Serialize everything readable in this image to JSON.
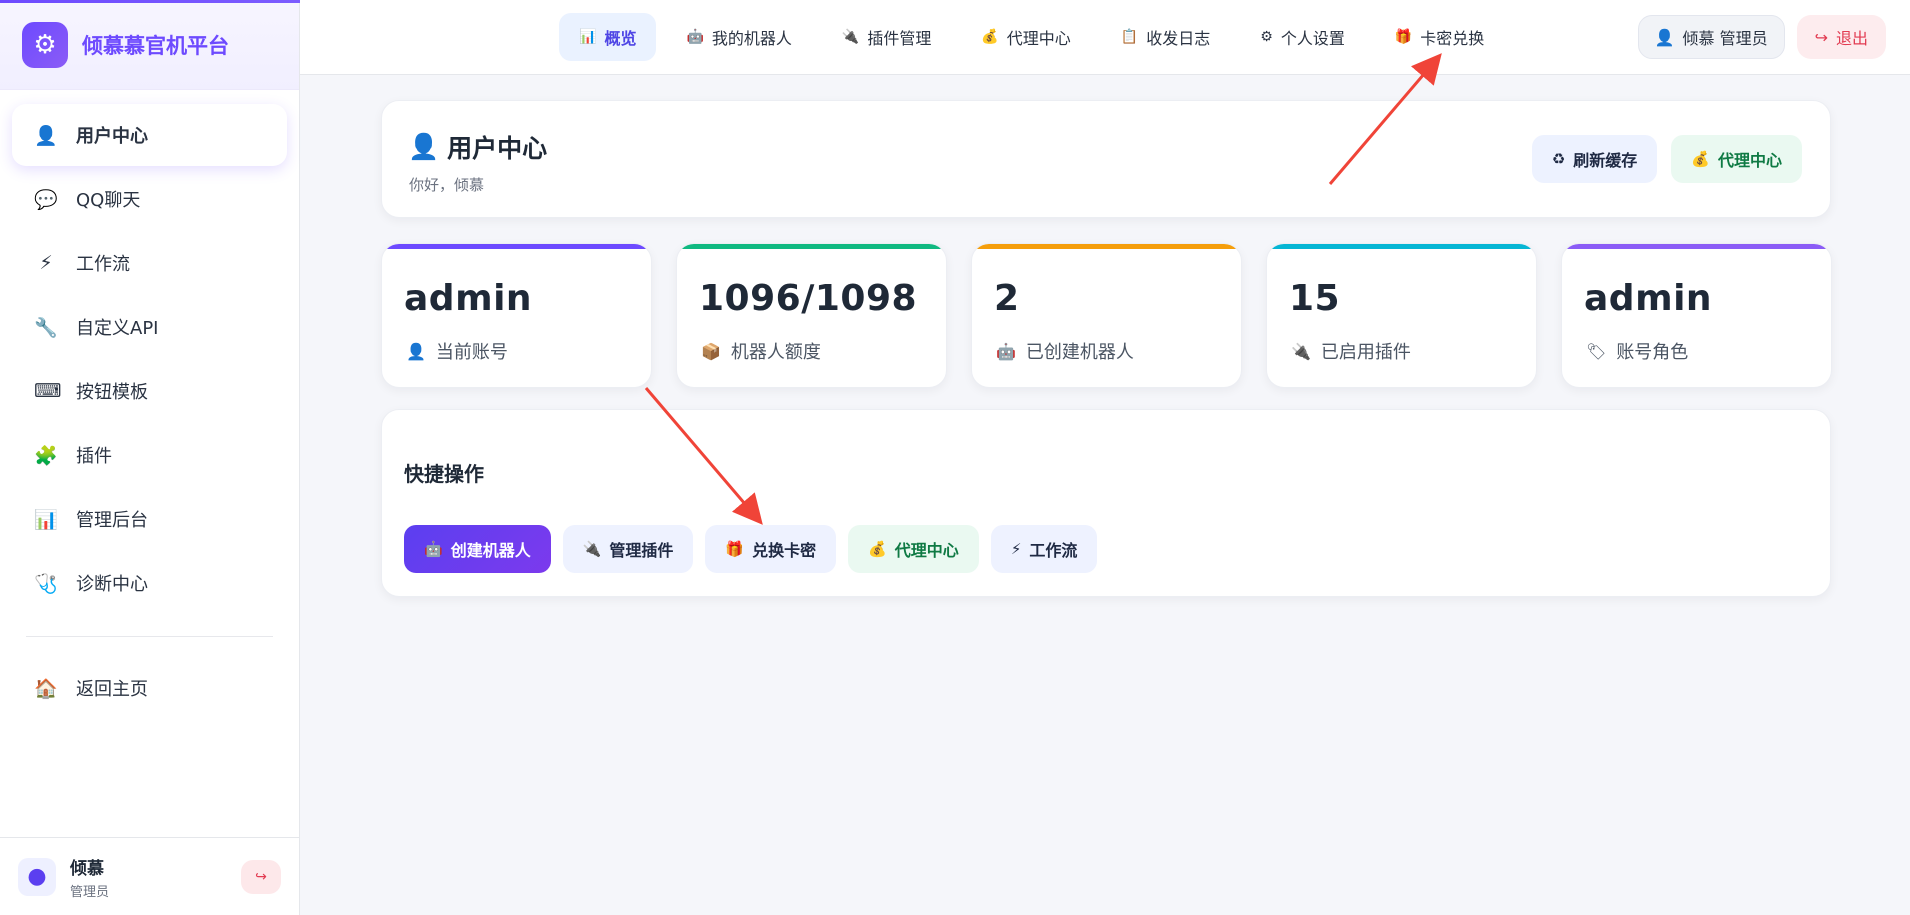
{
  "brand": {
    "title": "倾慕慕官机平台",
    "logo_icon": "gear-icon"
  },
  "sidebar": {
    "items": [
      {
        "label": "用户中心",
        "icon": "👤",
        "icon_name": "user-icon",
        "active": true
      },
      {
        "label": "QQ聊天",
        "icon": "💬",
        "icon_name": "chat-icon"
      },
      {
        "label": "工作流",
        "icon": "⚡",
        "icon_name": "bolt-icon"
      },
      {
        "label": "自定义API",
        "icon": "🔧",
        "icon_name": "wrench-icon"
      },
      {
        "label": "按钮模板",
        "icon": "⌨",
        "icon_name": "keyboard-icon"
      },
      {
        "label": "插件",
        "icon": "🧩",
        "icon_name": "puzzle-icon"
      },
      {
        "label": "管理后台",
        "icon": "📊",
        "icon_name": "chart-icon"
      },
      {
        "label": "诊断中心",
        "icon": "🩺",
        "icon_name": "stethoscope-icon"
      }
    ],
    "home": {
      "label": "返回主页",
      "icon": "🏠"
    },
    "footer": {
      "name": "倾慕",
      "role": "管理员",
      "avatar_icon": "user-circle-icon"
    }
  },
  "topnav": {
    "tabs": [
      {
        "label": "概览",
        "icon": "📊",
        "active": true
      },
      {
        "label": "我的机器人",
        "icon": "🤖"
      },
      {
        "label": "插件管理",
        "icon": "🔌"
      },
      {
        "label": "代理中心",
        "icon": "💰"
      },
      {
        "label": "收发日志",
        "icon": "📋"
      },
      {
        "label": "个人设置",
        "icon": "⚙"
      },
      {
        "label": "卡密兑换",
        "icon": "🎁"
      }
    ],
    "user_pill": "倾慕 管理员",
    "logout": "退出"
  },
  "header": {
    "title": "用户中心",
    "subtitle": "你好，倾慕",
    "refresh_label": "刷新缓存",
    "agent_label": "代理中心"
  },
  "stats": [
    {
      "value": "admin",
      "label": "当前账号",
      "icon": "👤",
      "color": "#6d4aff"
    },
    {
      "value": "1096/1098",
      "label": "机器人额度",
      "icon": "📦",
      "color": "#10b981"
    },
    {
      "value": "2",
      "label": "已创建机器人",
      "icon": "🤖",
      "color": "#f59e0b"
    },
    {
      "value": "15",
      "label": "已启用插件",
      "icon": "🔌",
      "color": "#06b6d4"
    },
    {
      "value": "admin",
      "label": "账号角色",
      "icon": "🏷",
      "color": "#8b5cf6"
    }
  ],
  "quick": {
    "title": "快捷操作",
    "buttons": [
      {
        "label": "创建机器人",
        "icon": "🤖",
        "style": "primary"
      },
      {
        "label": "管理插件",
        "icon": "🔌",
        "style": "soft"
      },
      {
        "label": "兑换卡密",
        "icon": "🎁",
        "style": "soft"
      },
      {
        "label": "代理中心",
        "icon": "💰",
        "style": "green"
      },
      {
        "label": "工作流",
        "icon": "⚡",
        "style": "soft"
      }
    ]
  },
  "colors": {
    "accent": "#6d4aff",
    "danger": "#e23c52",
    "annotation_arrow": "#f04438"
  }
}
